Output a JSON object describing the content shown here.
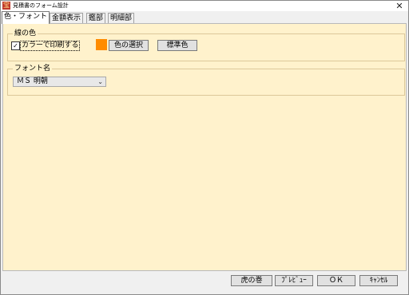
{
  "window": {
    "title": "見積書のフォーム設計",
    "app_icon": "宝",
    "close_glyph": "✕"
  },
  "tabs": [
    {
      "label": "色・フォント",
      "active": true
    },
    {
      "label": "金額表示",
      "active": false
    },
    {
      "label": "鑑部",
      "active": false
    },
    {
      "label": "明細部",
      "active": false
    }
  ],
  "line_color": {
    "legend": "線の色",
    "checkbox_label": "カラーで印刷する",
    "checkbox_checked": true,
    "checkmark": "✓",
    "swatch_color": "#ff8c00",
    "select_color_button": "色の選択",
    "standard_color_button": "標準色"
  },
  "font": {
    "legend": "フォント名",
    "selected": "ＭＳ 明朝",
    "arrow": "⌄"
  },
  "footer": {
    "tora_button": "虎の巻",
    "preview_button": "ﾌﾟﾚﾋﾞｭｰ",
    "ok_button": "ＯＫ",
    "cancel_button": "ｷｬﾝｾﾙ"
  },
  "colors": {
    "content_background": "#fff2cc",
    "accent_swatch": "#ff8c00"
  }
}
